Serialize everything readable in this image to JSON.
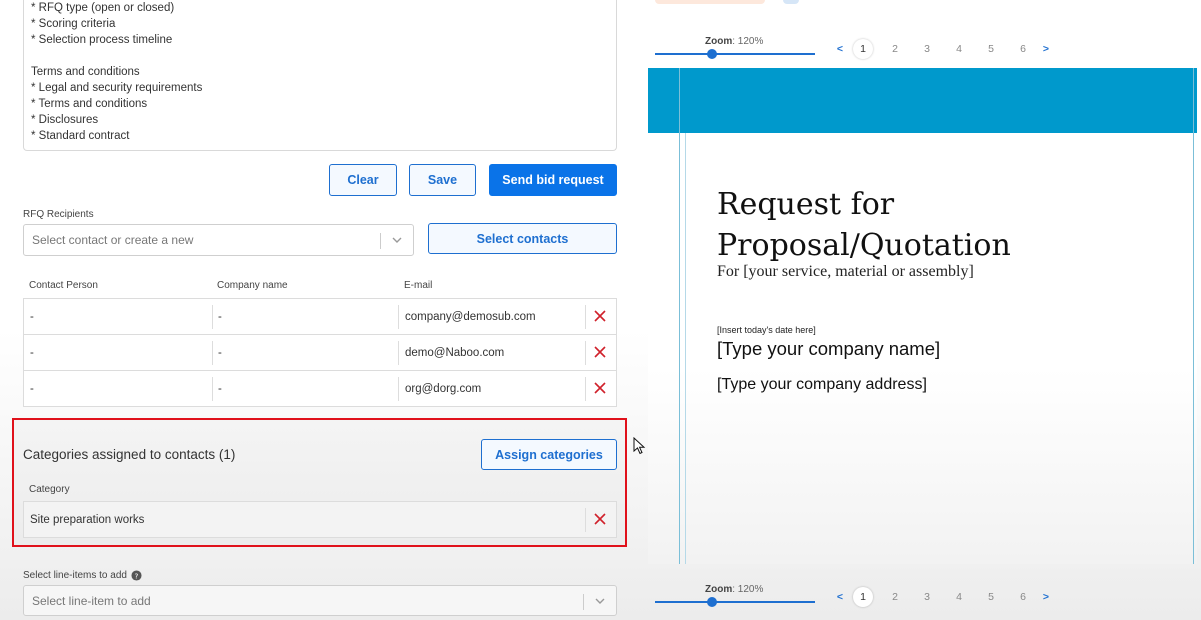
{
  "rfq_text": {
    "lines": [
      "* RFQ type (open or closed)",
      "* Scoring criteria",
      "* Selection process timeline",
      "",
      "Terms and conditions",
      "* Legal and security requirements",
      "* Terms and conditions",
      "* Disclosures",
      "* Standard contract"
    ]
  },
  "actions": {
    "clear_label": "Clear",
    "save_label": "Save",
    "send_label": "Send bid request"
  },
  "recipients": {
    "label": "RFQ Recipients",
    "select_placeholder": "Select contact or create a new",
    "select_contacts_label": "Select contacts",
    "columns": [
      "Contact Person",
      "Company name",
      "E-mail"
    ],
    "rows": [
      {
        "contact": "-",
        "company": "-",
        "email": "company@demosub.com"
      },
      {
        "contact": "-",
        "company": "-",
        "email": "demo@Naboo.com"
      },
      {
        "contact": "-",
        "company": "-",
        "email": "org@dorg.com"
      }
    ]
  },
  "categories": {
    "title": "Categories assigned to contacts (1)",
    "assign_label": "Assign categories",
    "column": "Category",
    "rows": [
      {
        "name": "Site preparation works"
      }
    ]
  },
  "line_items": {
    "label": "Select line-items to add",
    "placeholder": "Select line-item to add"
  },
  "viewer": {
    "zoom_label": "Zoom",
    "zoom_value": ": 120%",
    "zoom_level_percent": 120,
    "pages": [
      "1",
      "2",
      "3",
      "4",
      "5",
      "6"
    ],
    "current_page": "1",
    "prev": "<",
    "next": ">"
  },
  "document": {
    "title_line1": "Request for",
    "title_line2": "Proposal/Quotation",
    "subtitle": "For [your service, material or assembly]",
    "date": "[Insert today's date here]",
    "company": "[Type your company name]",
    "address": "[Type your company address]"
  },
  "colors": {
    "accent": "#0a73e8",
    "doc_band": "#0099cc",
    "highlight": "#e0111b",
    "remove": "#d0212b"
  }
}
